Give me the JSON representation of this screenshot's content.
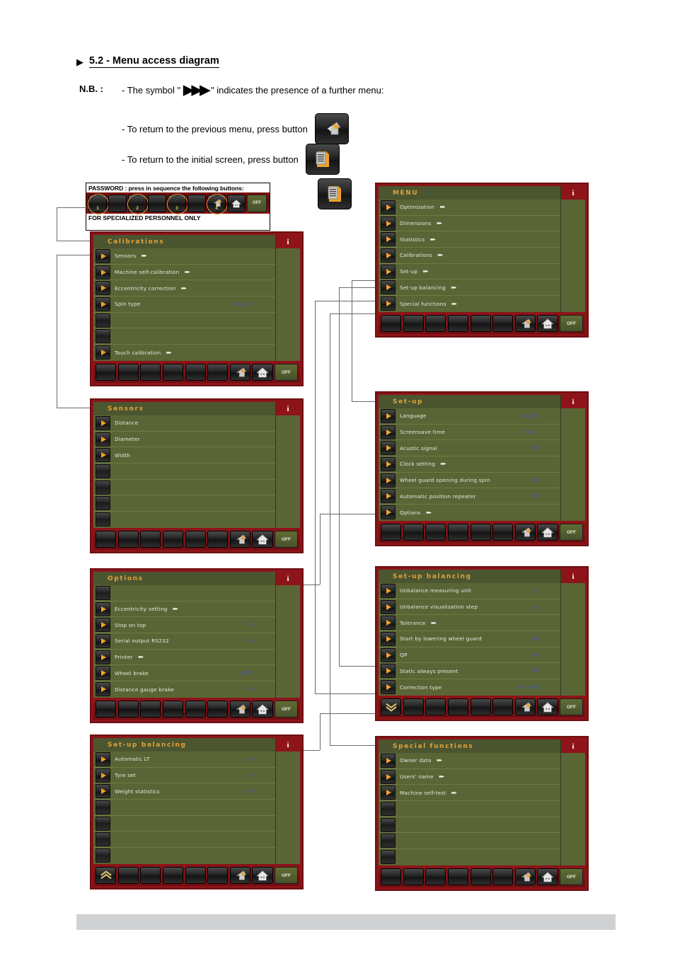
{
  "section": {
    "marker": "▶",
    "title": "5.2 - Menu access diagram"
  },
  "notes": {
    "label": "N.B. :",
    "line1_prefix": "- The symbol \"",
    "line1_suffix": "\"  indicates the presence of a further menu:",
    "symbol_glyph": "▶▶▶",
    "line2": "- To return to the previous menu, press button",
    "line3": "- To return to the initial screen, press button"
  },
  "icons": {
    "back": "back-arrow-icon",
    "home": "home-icon",
    "document": "document-icon",
    "info": "i",
    "off": "OFF",
    "triangle": "▸▸▸",
    "chevron_down": "ˇˇ",
    "chevron_up": "ˆˆ"
  },
  "password_box": {
    "title": "PASSWORD : press in sequence the following buttons:",
    "footer": "FOR SPECIALIZED PERSONNEL ONLY",
    "sequence": [
      "1",
      "2",
      "3",
      "4"
    ],
    "off_label": "OFF"
  },
  "colors": {
    "screen_frame_red": "#8d1418",
    "screen_green": "#5a6536",
    "title_amber": "#e0a13c",
    "value_blue": "#4a5a9a",
    "off_olive": "#606d34",
    "band_gray": "#d0d1d3"
  },
  "panels": {
    "menu": {
      "title": "MENU",
      "rows": [
        {
          "label": "Optimization",
          "tri": true,
          "value": ""
        },
        {
          "label": "Dimensions",
          "tri": true,
          "value": ""
        },
        {
          "label": "Statistics",
          "tri": true,
          "value": ""
        },
        {
          "label": "Calibrations",
          "tri": true,
          "value": ""
        },
        {
          "label": "Set-up",
          "tri": true,
          "value": ""
        },
        {
          "label": "Set-up balancing",
          "tri": true,
          "value": ""
        },
        {
          "label": "Special functions",
          "tri": true,
          "value": ""
        }
      ],
      "footer_first": ""
    },
    "calibrations": {
      "title": "Calibrations",
      "rows": [
        {
          "label": "Sensors",
          "tri": true,
          "value": ""
        },
        {
          "label": "Machine self-calibration",
          "tri": true,
          "value": ""
        },
        {
          "label": "Eccentricity correction",
          "tri": true,
          "value": ""
        },
        {
          "label": "Spin type",
          "tri": false,
          "value": "Standard"
        },
        {
          "label": "",
          "tri": false,
          "value": ""
        },
        {
          "label": "",
          "tri": false,
          "value": ""
        },
        {
          "label": "Touch calibration",
          "tri": true,
          "value": ""
        }
      ],
      "footer_first": ""
    },
    "sensors": {
      "title": "Sensors",
      "rows": [
        {
          "label": "Distance",
          "tri": false,
          "value": ""
        },
        {
          "label": "Diameter",
          "tri": false,
          "value": ""
        },
        {
          "label": "Width",
          "tri": false,
          "value": ""
        },
        {
          "label": "",
          "tri": false,
          "value": ""
        },
        {
          "label": "",
          "tri": false,
          "value": ""
        },
        {
          "label": "",
          "tri": false,
          "value": ""
        },
        {
          "label": "",
          "tri": false,
          "value": ""
        }
      ],
      "footer_first": ""
    },
    "setup": {
      "title": "Set-up",
      "rows": [
        {
          "label": "Language",
          "tri": false,
          "value": "English"
        },
        {
          "label": "Screensave time",
          "tri": false,
          "value": "5 min."
        },
        {
          "label": "Acustic signal",
          "tri": false,
          "value": "ON"
        },
        {
          "label": "Clock setting",
          "tri": true,
          "value": ""
        },
        {
          "label": "Wheel guard opening during spin",
          "tri": false,
          "value": "ON"
        },
        {
          "label": "Automatic position repeater",
          "tri": false,
          "value": "ON"
        },
        {
          "label": "Options",
          "tri": true,
          "value": ""
        }
      ],
      "footer_first": ""
    },
    "options": {
      "title": "Options",
      "rows": [
        {
          "label": "",
          "tri": false,
          "value": ""
        },
        {
          "label": "Eccentricity setting",
          "tri": true,
          "value": ""
        },
        {
          "label": "Stop on top",
          "tri": false,
          "value": "ON"
        },
        {
          "label": "Serial output RS232",
          "tri": false,
          "value": "ON"
        },
        {
          "label": "Printer",
          "tri": true,
          "value": ""
        },
        {
          "label": "Wheel brake",
          "tri": false,
          "value": "AUTO"
        },
        {
          "label": "Distance gauge brake",
          "tri": false,
          "value": "ON"
        }
      ],
      "footer_first": ""
    },
    "setup_balancing_1": {
      "title": "Set-up balancing",
      "rows": [
        {
          "label": "Unbalance measuring unit",
          "tri": false,
          "value": "g"
        },
        {
          "label": "Unbalance visualization step",
          "tri": false,
          "value": "1 g"
        },
        {
          "label": "Tolerance",
          "tri": true,
          "value": ""
        },
        {
          "label": "Start by lowering wheel guard",
          "tri": false,
          "value": "ON"
        },
        {
          "label": "QP",
          "tri": false,
          "value": "ON"
        },
        {
          "label": "Static always present",
          "tri": false,
          "value": "ON"
        },
        {
          "label": "Correction type",
          "tri": false,
          "value": "Standard"
        }
      ],
      "footer_first": "chevron-down"
    },
    "setup_balancing_2": {
      "title": "Set-up balancing",
      "rows": [
        {
          "label": "Automatic LT",
          "tri": false,
          "value": "ON"
        },
        {
          "label": "Tyre set",
          "tri": false,
          "value": "ON"
        },
        {
          "label": "Weight statistics",
          "tri": false,
          "value": "ON"
        },
        {
          "label": "",
          "tri": false,
          "value": ""
        },
        {
          "label": "",
          "tri": false,
          "value": ""
        },
        {
          "label": "",
          "tri": false,
          "value": ""
        },
        {
          "label": "",
          "tri": false,
          "value": ""
        }
      ],
      "footer_first": "chevron-up"
    },
    "special_functions": {
      "title": "Special functions",
      "rows": [
        {
          "label": "Owner data",
          "tri": true,
          "value": ""
        },
        {
          "label": "Users' name",
          "tri": true,
          "value": ""
        },
        {
          "label": "Machine self-test",
          "tri": true,
          "value": ""
        },
        {
          "label": "",
          "tri": false,
          "value": ""
        },
        {
          "label": "",
          "tri": false,
          "value": ""
        },
        {
          "label": "",
          "tri": false,
          "value": ""
        },
        {
          "label": "",
          "tri": false,
          "value": ""
        }
      ],
      "footer_first": ""
    }
  }
}
